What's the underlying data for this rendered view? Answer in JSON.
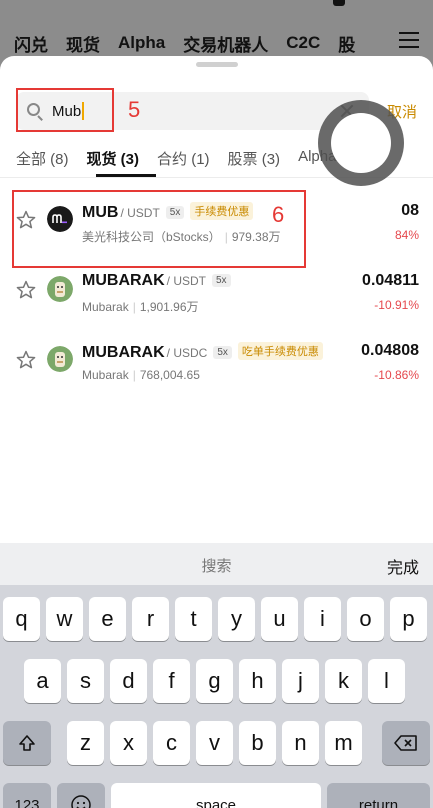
{
  "background_nav": {
    "tabs": [
      "闪兑",
      "现货",
      "Alpha",
      "交易机器人",
      "C2C",
      "股"
    ]
  },
  "search": {
    "value": "Mub",
    "cancel_label": "取消"
  },
  "annotations": {
    "search_marker": "5",
    "result_marker": "6"
  },
  "tabs": [
    {
      "label": "全部 (8)",
      "active": false
    },
    {
      "label": "现货 (3)",
      "active": true
    },
    {
      "label": "合约 (1)",
      "active": false
    },
    {
      "label": "股票 (3)",
      "active": false
    },
    {
      "label": "Alpha (1)",
      "active": false
    }
  ],
  "results": [
    {
      "symbol": "MUB",
      "quote": "/ USDT",
      "leverage": "5x",
      "promo": "手续费优惠",
      "name": "美光科技公司（bStocks）",
      "volume": "979.38万",
      "price": "08",
      "change": "84%",
      "logo_color": "#1a1a1a"
    },
    {
      "symbol": "MUBARAK",
      "quote": "/ USDT",
      "leverage": "5x",
      "promo": "",
      "name": "Mubarak",
      "volume": "1,901.96万",
      "price": "0.04811",
      "change": "-10.91%",
      "logo_color": "#7da86a"
    },
    {
      "symbol": "MUBARAK",
      "quote": "/ USDC",
      "leverage": "5x",
      "promo": "吃单手续费优惠",
      "name": "Mubarak",
      "volume": "768,004.65",
      "price": "0.04808",
      "change": "-10.86%",
      "logo_color": "#7da86a"
    }
  ],
  "keyboard": {
    "hint": "搜索",
    "done_label": "完成",
    "row1": [
      "q",
      "w",
      "e",
      "r",
      "t",
      "y",
      "u",
      "i",
      "o",
      "p"
    ],
    "row2": [
      "a",
      "s",
      "d",
      "f",
      "g",
      "h",
      "j",
      "k",
      "l"
    ],
    "row3": [
      "z",
      "x",
      "c",
      "v",
      "b",
      "n",
      "m"
    ],
    "numbers_label": "123",
    "space_label": "space",
    "return_label": "return"
  },
  "colors": {
    "accent": "#c98a00",
    "negative": "#e5484d",
    "annotation": "#e53935"
  }
}
